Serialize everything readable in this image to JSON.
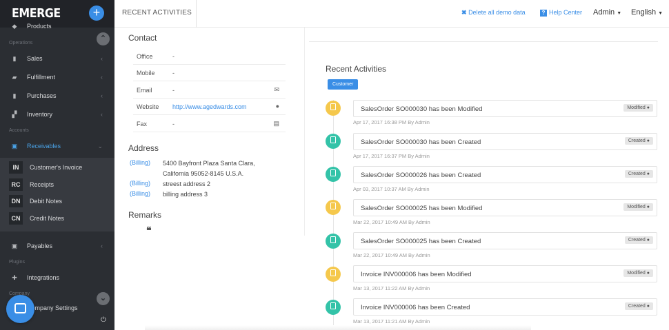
{
  "app": {
    "logo": "EMERGE",
    "add_label": "+"
  },
  "sidebar": {
    "top_partial": {
      "label": "Products",
      "icon": "tag-icon"
    },
    "sections": {
      "operations": "Operations",
      "accounts": "Accounts",
      "plugins": "Plugins",
      "company": "Company"
    },
    "items": {
      "sales": {
        "label": "Sales",
        "icon": "book-icon"
      },
      "fulfillment": {
        "label": "Fulfillment",
        "icon": "truck-icon"
      },
      "purchases": {
        "label": "Purchases",
        "icon": "book-icon"
      },
      "inventory": {
        "label": "Inventory",
        "icon": "cubes-icon"
      },
      "receivables": {
        "label": "Receivables",
        "icon": "money-icon"
      },
      "payables": {
        "label": "Payables",
        "icon": "money-icon"
      },
      "integrations": {
        "label": "Integrations",
        "icon": "puzzle-icon"
      },
      "company_settings": {
        "label": "Company Settings",
        "icon": "gear-icon"
      }
    },
    "sub_items": [
      {
        "abbr": "IN",
        "label": "Customer's Invoice"
      },
      {
        "abbr": "RC",
        "label": "Receipts"
      },
      {
        "abbr": "DN",
        "label": "Debit Notes"
      },
      {
        "abbr": "CN",
        "label": "Credit Notes"
      }
    ],
    "chevron": "‹"
  },
  "topbar": {
    "tab": "RECENT ACTIVITIES",
    "delete_demo": "Delete all demo data",
    "help_center": "Help Center",
    "admin": "Admin",
    "language": "English"
  },
  "contact": {
    "heading": "Contact",
    "rows": [
      {
        "label": "Office",
        "value": "-"
      },
      {
        "label": "Mobile",
        "value": "-"
      },
      {
        "label": "Email",
        "value": "-",
        "icon": "envelope-icon"
      },
      {
        "label": "Website",
        "value": "http://www.agedwards.com",
        "icon": "globe-icon"
      },
      {
        "label": "Fax",
        "value": "-",
        "icon": "fax-icon"
      }
    ]
  },
  "address": {
    "heading": "Address",
    "tag": "(Billing)",
    "lines": [
      "5400 Bayfront Plaza Santa Clara,",
      "California 95052-8145 U.S.A.",
      "streest address 2",
      "billing address 3"
    ]
  },
  "remarks": {
    "heading": "Remarks",
    "quote": "❝"
  },
  "activities": {
    "heading": "Recent Activities",
    "badge": "Customer",
    "items": [
      {
        "text": "SalesOrder SO000030 has been Modified",
        "tag": "Modified",
        "meta": "Apr 17, 2017 16:38 PM By Admin",
        "kind": "modified"
      },
      {
        "text": "SalesOrder SO000030 has been Created",
        "tag": "Created",
        "meta": "Apr 17, 2017 16:37 PM By Admin",
        "kind": "created"
      },
      {
        "text": "SalesOrder SO000026 has been Created",
        "tag": "Created",
        "meta": "Apr 03, 2017 10:37 AM By Admin",
        "kind": "created"
      },
      {
        "text": "SalesOrder SO000025 has been Modified",
        "tag": "Modified",
        "meta": "Mar 22, 2017 10:49 AM By Admin",
        "kind": "modified"
      },
      {
        "text": "SalesOrder SO000025 has been Created",
        "tag": "Created",
        "meta": "Mar 22, 2017 10:49 AM By Admin",
        "kind": "created"
      },
      {
        "text": "Invoice INV000006 has been Modified",
        "tag": "Modified",
        "meta": "Mar 13, 2017 11:22 AM By Admin",
        "kind": "modified"
      },
      {
        "text": "Invoice INV000006 has been Created",
        "tag": "Created",
        "meta": "Mar 13, 2017 11:21 AM By Admin",
        "kind": "created"
      }
    ]
  },
  "colors": {
    "accent": "#3a8ee6",
    "modified": "#f5c84c",
    "created": "#33c3a8",
    "sidebar": "#2b2e33"
  }
}
